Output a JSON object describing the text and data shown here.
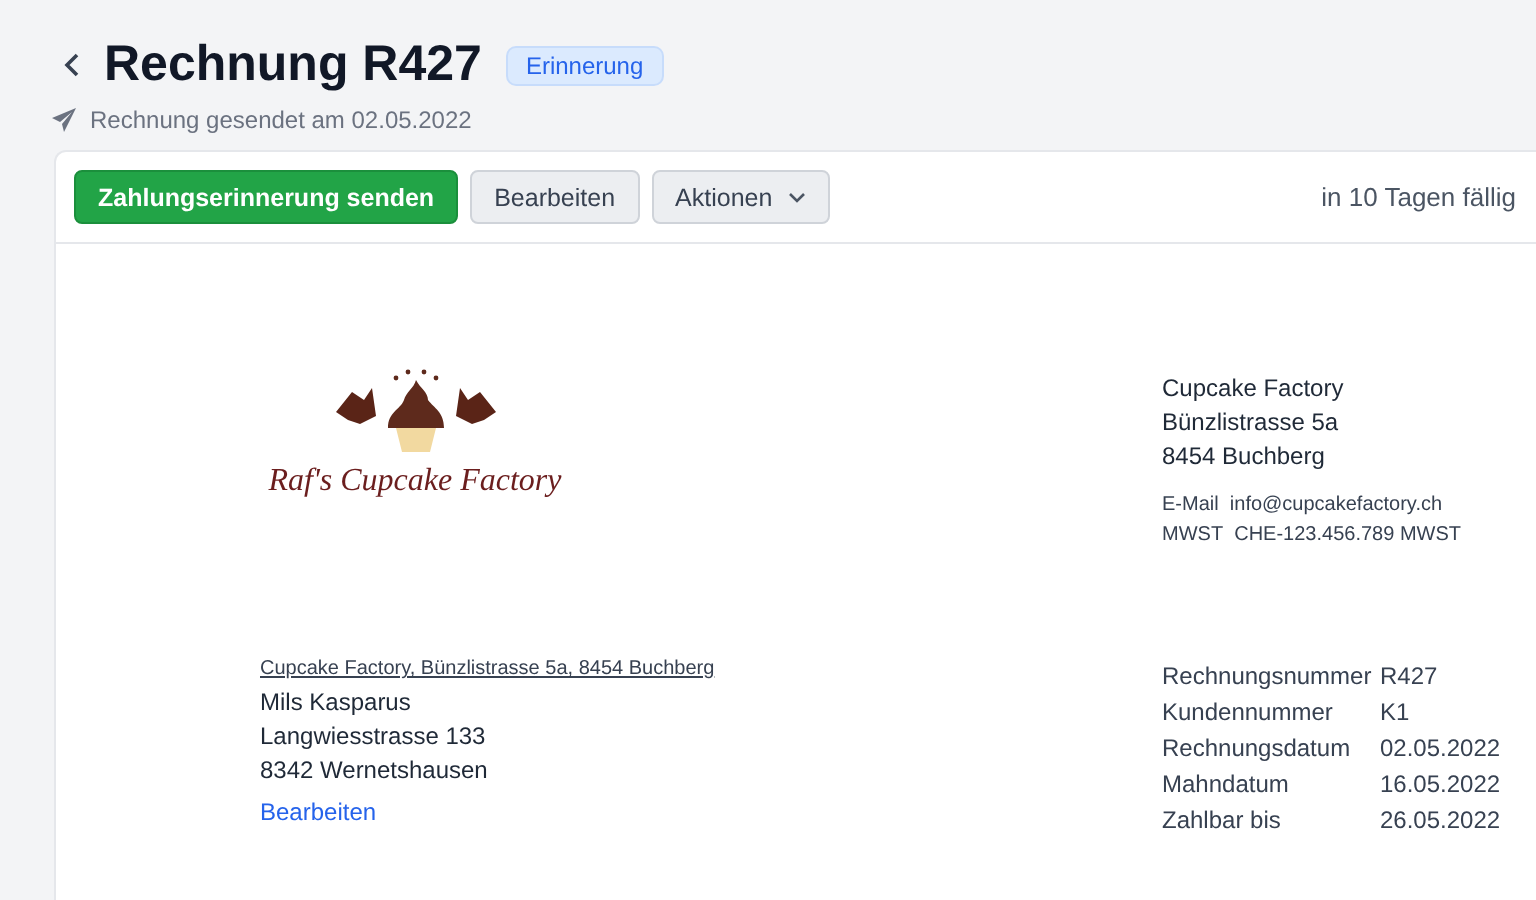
{
  "header": {
    "title": "Rechnung R427",
    "badge": "Erinnerung",
    "subtitle": "Rechnung gesendet am 02.05.2022"
  },
  "toolbar": {
    "buttons": [
      {
        "kind": "primary",
        "label": "Zahlungserinnerung senden"
      },
      {
        "kind": "secondary",
        "label": "Bearbeiten"
      },
      {
        "kind": "dropdown",
        "label": "Aktionen"
      }
    ],
    "due": "in 10 Tagen fällig"
  },
  "logo": {
    "text": "Raf's Cupcake Factory"
  },
  "sender": {
    "lines": [
      "Cupcake Factory",
      "Bünzlistrasse 5a",
      "8454 Buchberg"
    ],
    "contacts": [
      {
        "label": "E-Mail",
        "value": "info@cupcakefactory.ch"
      },
      {
        "label": "MWST",
        "value": "CHE-123.456.789 MWST"
      }
    ]
  },
  "recipient": {
    "return_line": "Cupcake Factory, Bünzlistrasse 5a, 8454 Buchberg",
    "lines": [
      "Mils Kasparus",
      "Langwiesstrasse 133",
      "8342 Wernetshausen"
    ],
    "edit_link": "Bearbeiten"
  },
  "meta": [
    {
      "label": "Rechnungsnummer",
      "value": "R427"
    },
    {
      "label": "Kundennummer",
      "value": "K1"
    },
    {
      "label": "Rechnungsdatum",
      "value": "02.05.2022"
    },
    {
      "label": "Mahndatum",
      "value": "16.05.2022"
    },
    {
      "label": "Zahlbar bis",
      "value": "26.05.2022"
    }
  ]
}
